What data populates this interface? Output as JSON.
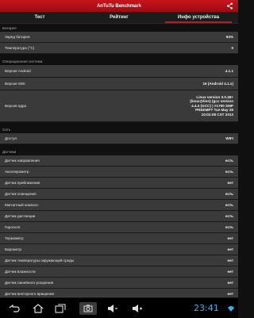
{
  "app": {
    "title": "AnTuTu Benchmark",
    "share_icon": "share-icon"
  },
  "tabs": [
    {
      "label": "Тест"
    },
    {
      "label": "Рейтинг"
    },
    {
      "label": "Инфо устройства",
      "active": true
    }
  ],
  "sections": [
    {
      "header": "Батарея",
      "rows": [
        {
          "label": "Заряд батареи",
          "value": "94%"
        },
        {
          "label": "Температура (°C)",
          "value": "0"
        }
      ]
    },
    {
      "header": "Операционная система",
      "rows": [
        {
          "label": "Версия Android",
          "value": "4.1.1"
        },
        {
          "label": "Версия SDK",
          "value": "16  (Android 4.1.x)"
        },
        {
          "label": "Версия ядра",
          "value": "Linux version 3.0.36+\n(linux@linn) (gcc version\n4.4.3 (GCC) ) #1790 SMP\nPREEMPT Tue May 28\n10:02:08 CST 2013"
        }
      ]
    },
    {
      "header": "Сеть",
      "rows": [
        {
          "label": "Доступ",
          "value": "WIFI"
        }
      ]
    },
    {
      "header": "Датчики",
      "rows": [
        {
          "label": "Датчик направления",
          "value": "есть"
        },
        {
          "label": "Акселерометр",
          "value": "есть"
        },
        {
          "label": "Датчик приближения",
          "value": "нет"
        },
        {
          "label": "Датчик освещения",
          "value": "есть"
        },
        {
          "label": "Магнитный компасс",
          "value": "есть"
        },
        {
          "label": "Датчик дистанции",
          "value": "есть"
        },
        {
          "label": "Гироскоп",
          "value": "есть"
        },
        {
          "label": "Термометр",
          "value": "нет"
        },
        {
          "label": "Барометр",
          "value": "нет"
        },
        {
          "label": "Датчик температуры окружающей среды",
          "value": "нет"
        },
        {
          "label": "Датчик влажности",
          "value": "нет"
        },
        {
          "label": "Датчик линейного ускорения",
          "value": "нет"
        },
        {
          "label": "Датчик векторного вращения",
          "value": "нет"
        }
      ]
    }
  ],
  "statusbar": {
    "time": "23:41",
    "accent_color": "#33b5e5",
    "icons": [
      "back-icon",
      "home-icon",
      "recent-apps-icon",
      "screenshot-icon",
      "volume-down-icon",
      "volume-up-icon",
      "wifi-icon"
    ]
  }
}
